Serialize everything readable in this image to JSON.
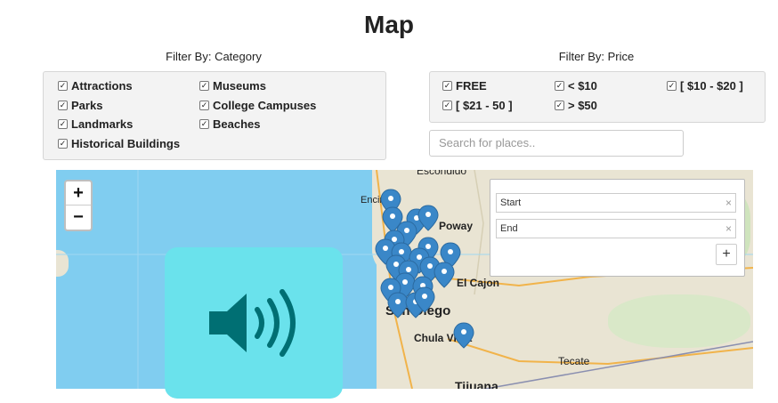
{
  "page": {
    "title": "Map"
  },
  "filters": {
    "category": {
      "label": "Filter By: Category",
      "options": [
        {
          "label": "Attractions",
          "checked": true
        },
        {
          "label": "Museums",
          "checked": true
        },
        {
          "label": "Parks",
          "checked": true
        },
        {
          "label": "College Campuses",
          "checked": true
        },
        {
          "label": "Landmarks",
          "checked": true
        },
        {
          "label": "Beaches",
          "checked": true
        },
        {
          "label": "Historical Buildings",
          "checked": true
        }
      ]
    },
    "price": {
      "label": "Filter By: Price",
      "options": [
        {
          "label": "FREE",
          "checked": true
        },
        {
          "label": "< $10",
          "checked": true
        },
        {
          "label": "[ $10 - $20 ]",
          "checked": true
        },
        {
          "label": "[ $21 - 50 ]",
          "checked": true
        },
        {
          "label": "> $50",
          "checked": true
        }
      ]
    }
  },
  "search": {
    "placeholder": "Search for places.."
  },
  "map": {
    "zoom_in": "+",
    "zoom_out": "−",
    "places": [
      "Escondido",
      "Encinitas",
      "Poway",
      "El Cajon",
      "San Diego",
      "Chula Vista",
      "Tecate",
      "Tijuana"
    ],
    "routing": {
      "start_placeholder": "Start",
      "end_placeholder": "End",
      "clear": "×",
      "add_button": "+"
    },
    "pin_color": "#3a87c8",
    "icons": {
      "speaker": "speaker-icon",
      "pin": "map-pin-icon"
    }
  }
}
